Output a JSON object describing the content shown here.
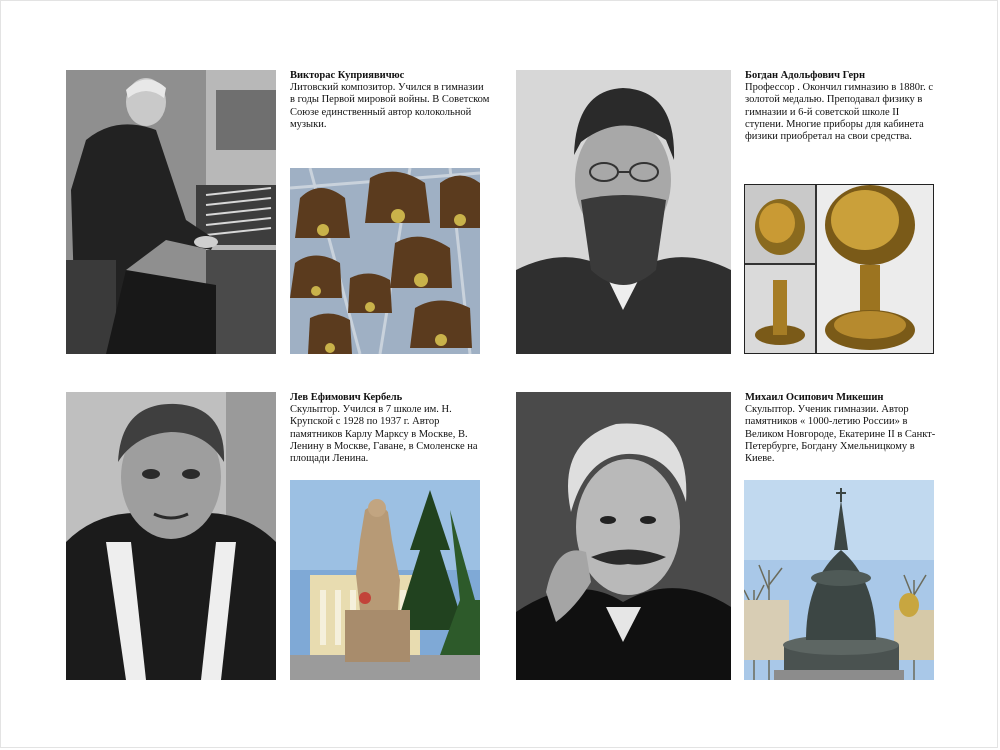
{
  "sections": [
    {
      "name": "Викторас Куприявичюс",
      "bio": "Литовский композитор. Учился в гимназии в годы Первой мировой войны. В Советском Союзе единственный автор колокольной музыки."
    },
    {
      "name": "Богдан Адольфович Герн",
      "bio": "Профессор . Окончил гимназию в 1880г. с золотой медалью. Преподавал физику в гимназии и 6-й советской школе II ступени. Многие приборы для кабинета физики приобретал на свои средства."
    },
    {
      "name": "Лев Ефимович Кербель",
      "bio": "Скульптор. Учился в 7 школе им. Н. Крупской с 1928 по 1937 г. Автор памятников Карлу Марксу в Москве, В. Ленину в Москве, Гаване, в Смоленске на площади Ленина."
    },
    {
      "name": "Михаил Осипович Микешин",
      "bio": "Скульптор. Ученик гимназии. Автор памятников « 1000-летию России» в Великом Новгороде, Екатерине II в Санкт- Петербурге, Богдану Хмельницкому в Киеве."
    }
  ]
}
